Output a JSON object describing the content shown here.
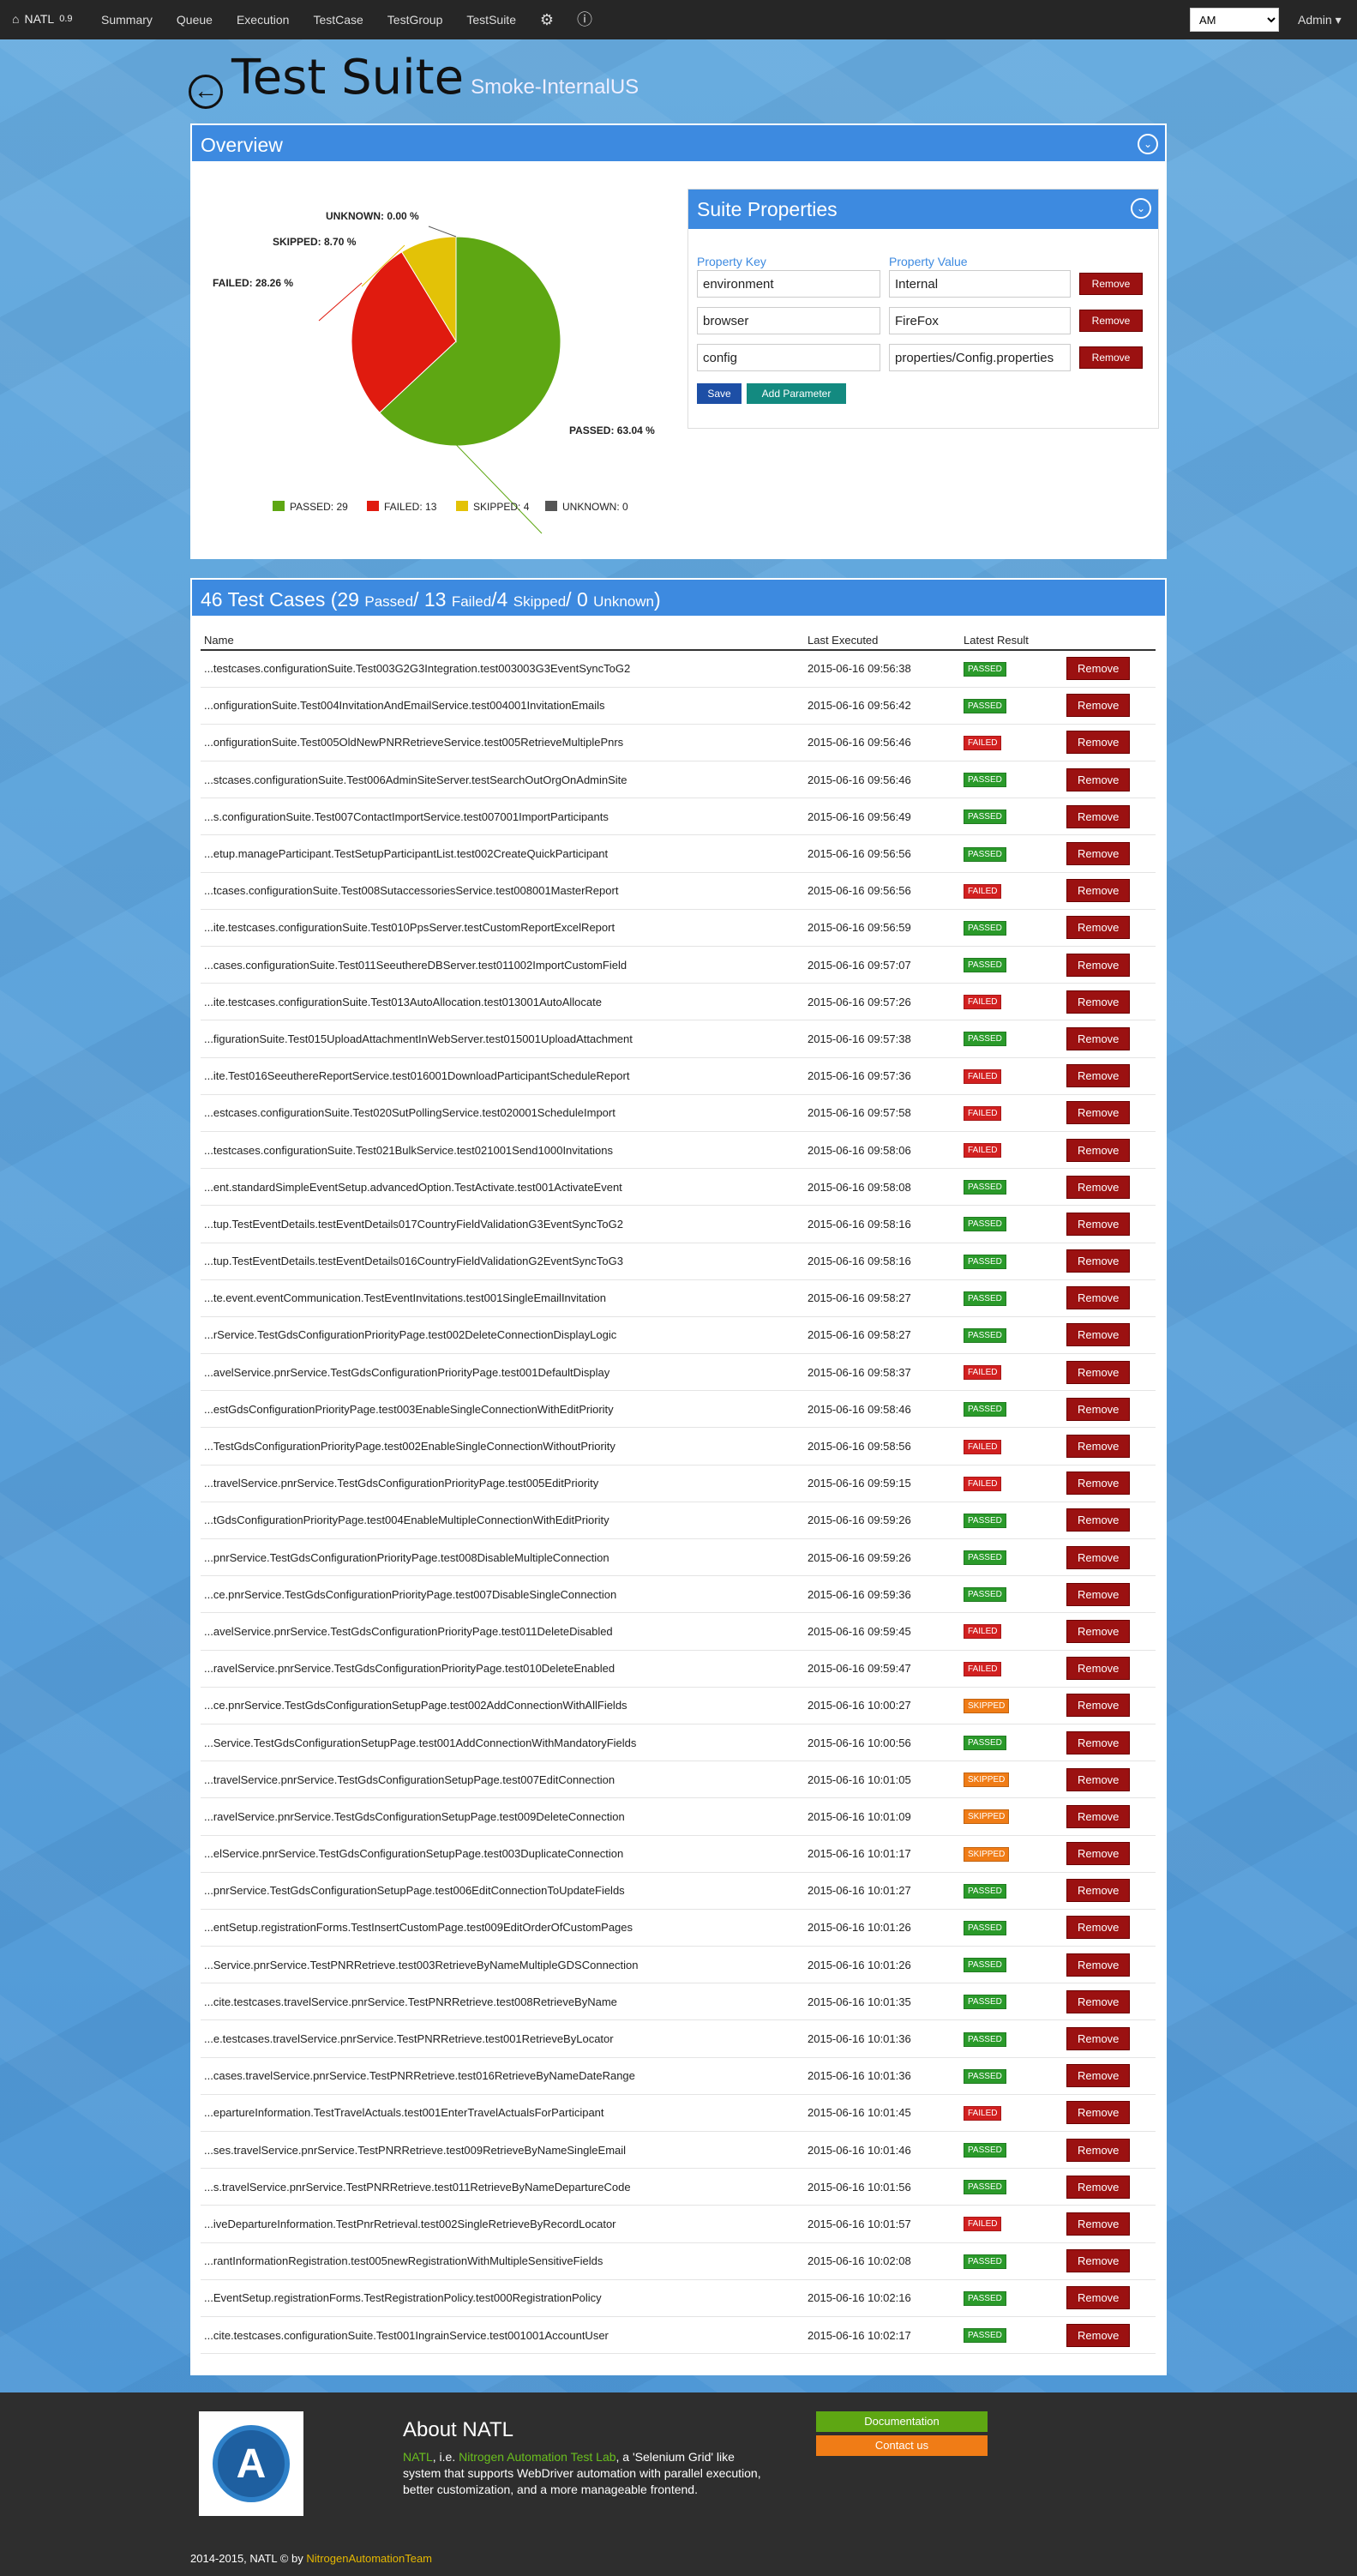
{
  "nav": {
    "brand": "NATL",
    "version": "0.9",
    "items": [
      "Summary",
      "Queue",
      "Execution",
      "TestCase",
      "TestGroup",
      "TestSuite"
    ],
    "env_select": "AM",
    "user": "Admin"
  },
  "page": {
    "title": "Test Suite",
    "suite_name": "Smoke-InternalUS"
  },
  "overview": {
    "title": "Overview"
  },
  "chart_data": {
    "type": "pie",
    "slices": [
      {
        "label": "PASSED",
        "value": 29,
        "percent": "63.04 %",
        "color": "#5ea713"
      },
      {
        "label": "FAILED",
        "value": 13,
        "percent": "28.26 %",
        "color": "#e01b0f"
      },
      {
        "label": "SKIPPED",
        "value": 4,
        "percent": "8.70 %",
        "color": "#e3c207"
      },
      {
        "label": "UNKNOWN",
        "value": 0,
        "percent": "0.00 %",
        "color": "#555555"
      }
    ],
    "labels": {
      "passed": "PASSED: 63.04 %",
      "failed": "FAILED: 28.26 %",
      "skipped": "SKIPPED: 8.70 %",
      "unknown": "UNKNOWN: 0.00 %"
    },
    "legend": {
      "passed": "PASSED: 29",
      "failed": "FAILED: 13",
      "skipped": "SKIPPED: 4",
      "unknown": "UNKNOWN: 0"
    }
  },
  "properties": {
    "title": "Suite Properties",
    "key_label": "Property Key",
    "value_label": "Property Value",
    "rows": [
      {
        "key": "environment",
        "value": "Internal"
      },
      {
        "key": "browser",
        "value": "FireFox"
      },
      {
        "key": "config",
        "value": "properties/Config.properties"
      }
    ],
    "remove_label": "Remove",
    "save_label": "Save",
    "add_label": "Add Parameter"
  },
  "cases": {
    "total": "46 Test Cases",
    "passed": "29",
    "passed_label": "Passed",
    "failed": "13",
    "failed_label": "Failed",
    "skipped": "4",
    "skipped_label": "Skipped",
    "unknown": "0",
    "unknown_label": "Unknown",
    "headers": {
      "name": "Name",
      "last": "Last Executed",
      "result": "Latest Result"
    },
    "remove_label": "Remove",
    "rows": [
      [
        "...testcases.configurationSuite.Test003G2G3Integration.test003003G3EventSyncToG2",
        "2015-06-16 09:56:38",
        "PASSED"
      ],
      [
        "...onfigurationSuite.Test004InvitationAndEmailService.test004001InvitationEmails",
        "2015-06-16 09:56:42",
        "PASSED"
      ],
      [
        "...onfigurationSuite.Test005OldNewPNRRetrieveService.test005RetrieveMultiplePnrs",
        "2015-06-16 09:56:46",
        "FAILED"
      ],
      [
        "...stcases.configurationSuite.Test006AdminSiteServer.testSearchOutOrgOnAdminSite",
        "2015-06-16 09:56:46",
        "PASSED"
      ],
      [
        "...s.configurationSuite.Test007ContactImportService.test007001ImportParticipants",
        "2015-06-16 09:56:49",
        "PASSED"
      ],
      [
        "...etup.manageParticipant.TestSetupParticipantList.test002CreateQuickParticipant",
        "2015-06-16 09:56:56",
        "PASSED"
      ],
      [
        "...tcases.configurationSuite.Test008SutaccessoriesService.test008001MasterReport",
        "2015-06-16 09:56:56",
        "FAILED"
      ],
      [
        "...ite.testcases.configurationSuite.Test010PpsServer.testCustomReportExcelReport",
        "2015-06-16 09:56:59",
        "PASSED"
      ],
      [
        "...cases.configurationSuite.Test011SeeuthereDBServer.test011002ImportCustomField",
        "2015-06-16 09:57:07",
        "PASSED"
      ],
      [
        "...ite.testcases.configurationSuite.Test013AutoAllocation.test013001AutoAllocate",
        "2015-06-16 09:57:26",
        "FAILED"
      ],
      [
        "...figurationSuite.Test015UploadAttachmentInWebServer.test015001UploadAttachment",
        "2015-06-16 09:57:38",
        "PASSED"
      ],
      [
        "...ite.Test016SeeuthereReportService.test016001DownloadParticipantScheduleReport",
        "2015-06-16 09:57:36",
        "FAILED"
      ],
      [
        "...estcases.configurationSuite.Test020SutPollingService.test020001ScheduleImport",
        "2015-06-16 09:57:58",
        "FAILED"
      ],
      [
        "...testcases.configurationSuite.Test021BulkService.test021001Send1000Invitations",
        "2015-06-16 09:58:06",
        "FAILED"
      ],
      [
        "...ent.standardSimpleEventSetup.advancedOption.TestActivate.test001ActivateEvent",
        "2015-06-16 09:58:08",
        "PASSED"
      ],
      [
        "...tup.TestEventDetails.testEventDetails017CountryFieldValidationG3EventSyncToG2",
        "2015-06-16 09:58:16",
        "PASSED"
      ],
      [
        "...tup.TestEventDetails.testEventDetails016CountryFieldValidationG2EventSyncToG3",
        "2015-06-16 09:58:16",
        "PASSED"
      ],
      [
        "...te.event.eventCommunication.TestEventInvitations.test001SingleEmailInvitation",
        "2015-06-16 09:58:27",
        "PASSED"
      ],
      [
        "...rService.TestGdsConfigurationPriorityPage.test002DeleteConnectionDisplayLogic",
        "2015-06-16 09:58:27",
        "PASSED"
      ],
      [
        "...avelService.pnrService.TestGdsConfigurationPriorityPage.test001DefaultDisplay",
        "2015-06-16 09:58:37",
        "FAILED"
      ],
      [
        "...estGdsConfigurationPriorityPage.test003EnableSingleConnectionWithEditPriority",
        "2015-06-16 09:58:46",
        "PASSED"
      ],
      [
        "...TestGdsConfigurationPriorityPage.test002EnableSingleConnectionWithoutPriority",
        "2015-06-16 09:58:56",
        "FAILED"
      ],
      [
        "...travelService.pnrService.TestGdsConfigurationPriorityPage.test005EditPriority",
        "2015-06-16 09:59:15",
        "FAILED"
      ],
      [
        "...tGdsConfigurationPriorityPage.test004EnableMultipleConnectionWithEditPriority",
        "2015-06-16 09:59:26",
        "PASSED"
      ],
      [
        "...pnrService.TestGdsConfigurationPriorityPage.test008DisableMultipleConnection",
        "2015-06-16 09:59:26",
        "PASSED"
      ],
      [
        "...ce.pnrService.TestGdsConfigurationPriorityPage.test007DisableSingleConnection",
        "2015-06-16 09:59:36",
        "PASSED"
      ],
      [
        "...avelService.pnrService.TestGdsConfigurationPriorityPage.test011DeleteDisabled",
        "2015-06-16 09:59:45",
        "FAILED"
      ],
      [
        "...ravelService.pnrService.TestGdsConfigurationPriorityPage.test010DeleteEnabled",
        "2015-06-16 09:59:47",
        "FAILED"
      ],
      [
        "...ce.pnrService.TestGdsConfigurationSetupPage.test002AddConnectionWithAllFields",
        "2015-06-16 10:00:27",
        "SKIPPED"
      ],
      [
        "...Service.TestGdsConfigurationSetupPage.test001AddConnectionWithMandatoryFields",
        "2015-06-16 10:00:56",
        "PASSED"
      ],
      [
        "...travelService.pnrService.TestGdsConfigurationSetupPage.test007EditConnection",
        "2015-06-16 10:01:05",
        "SKIPPED"
      ],
      [
        "...ravelService.pnrService.TestGdsConfigurationSetupPage.test009DeleteConnection",
        "2015-06-16 10:01:09",
        "SKIPPED"
      ],
      [
        "...elService.pnrService.TestGdsConfigurationSetupPage.test003DuplicateConnection",
        "2015-06-16 10:01:17",
        "SKIPPED"
      ],
      [
        "...pnrService.TestGdsConfigurationSetupPage.test006EditConnectionToUpdateFields",
        "2015-06-16 10:01:27",
        "PASSED"
      ],
      [
        "...entSetup.registrationForms.TestInsertCustomPage.test009EditOrderOfCustomPages",
        "2015-06-16 10:01:26",
        "PASSED"
      ],
      [
        "...Service.pnrService.TestPNRRetrieve.test003RetrieveByNameMultipleGDSConnection",
        "2015-06-16 10:01:26",
        "PASSED"
      ],
      [
        "...cite.testcases.travelService.pnrService.TestPNRRetrieve.test008RetrieveByName",
        "2015-06-16 10:01:35",
        "PASSED"
      ],
      [
        "...e.testcases.travelService.pnrService.TestPNRRetrieve.test001RetrieveByLocator",
        "2015-06-16 10:01:36",
        "PASSED"
      ],
      [
        "...cases.travelService.pnrService.TestPNRRetrieve.test016RetrieveByNameDateRange",
        "2015-06-16 10:01:36",
        "PASSED"
      ],
      [
        "...epartureInformation.TestTravelActuals.test001EnterTravelActualsForParticipant",
        "2015-06-16 10:01:45",
        "FAILED"
      ],
      [
        "...ses.travelService.pnrService.TestPNRRetrieve.test009RetrieveByNameSingleEmail",
        "2015-06-16 10:01:46",
        "PASSED"
      ],
      [
        "...s.travelService.pnrService.TestPNRRetrieve.test011RetrieveByNameDepartureCode",
        "2015-06-16 10:01:56",
        "PASSED"
      ],
      [
        "...iveDepartureInformation.TestPnrRetrieval.test002SingleRetrieveByRecordLocator",
        "2015-06-16 10:01:57",
        "FAILED"
      ],
      [
        "...rantInformationRegistration.test005newRegistrationWithMultipleSensitiveFields",
        "2015-06-16 10:02:08",
        "PASSED"
      ],
      [
        "...EventSetup.registrationForms.TestRegistrationPolicy.test000RegistrationPolicy",
        "2015-06-16 10:02:16",
        "PASSED"
      ],
      [
        "...cite.testcases.configurationSuite.Test001IngrainService.test001001AccountUser",
        "2015-06-16 10:02:17",
        "PASSED"
      ]
    ]
  },
  "footer": {
    "about_title": "About NATL",
    "about_pre": "NATL",
    "about_mid": ", i.e. ",
    "about_name": "Nitrogen Automation Test Lab",
    "about_text": ", a 'Selenium Grid' like system that supports WebDriver automation with parallel execution, better customization, and a more manageable frontend.",
    "doc_label": "Documentation",
    "contact_label": "Contact us",
    "copyright": "2014-2015, NATL © by ",
    "team": "NitrogenAutomationTeam",
    "logo_letter": "A"
  }
}
